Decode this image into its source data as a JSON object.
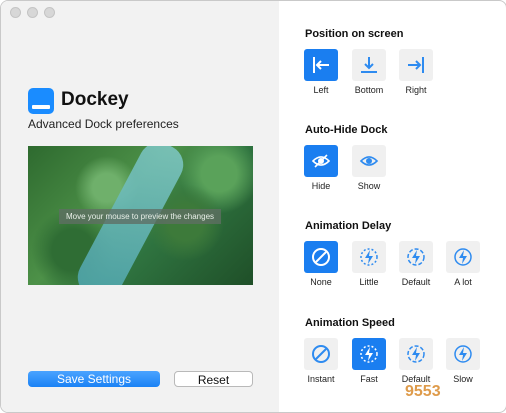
{
  "window": {
    "traffic_lights": [
      "close",
      "minimize",
      "zoom"
    ]
  },
  "app": {
    "title": "Dockey",
    "subtitle": "Advanced Dock preferences",
    "icon": "dock-icon"
  },
  "preview": {
    "hint": "Move your mouse to preview the changes"
  },
  "buttons": {
    "save": "Save Settings",
    "reset": "Reset"
  },
  "sections": {
    "position": {
      "title": "Position on screen",
      "options": [
        {
          "label": "Left",
          "icon": "arrow-left-icon",
          "selected": true
        },
        {
          "label": "Bottom",
          "icon": "arrow-down-icon",
          "selected": false
        },
        {
          "label": "Right",
          "icon": "arrow-right-icon",
          "selected": false
        }
      ]
    },
    "autohide": {
      "title": "Auto-Hide Dock",
      "options": [
        {
          "label": "Hide",
          "icon": "eye-slash-icon",
          "selected": true
        },
        {
          "label": "Show",
          "icon": "eye-icon",
          "selected": false
        }
      ]
    },
    "delay": {
      "title": "Animation Delay",
      "options": [
        {
          "label": "None",
          "icon": "no-icon",
          "selected": true
        },
        {
          "label": "Little",
          "icon": "bolt-dotted-icon",
          "selected": false
        },
        {
          "label": "Default",
          "icon": "bolt-dotted-icon",
          "selected": false
        },
        {
          "label": "A lot",
          "icon": "bolt-circle-icon",
          "selected": false
        }
      ]
    },
    "speed": {
      "title": "Animation Speed",
      "options": [
        {
          "label": "Instant",
          "icon": "no-icon",
          "selected": false
        },
        {
          "label": "Fast",
          "icon": "bolt-dotted-icon",
          "selected": true
        },
        {
          "label": "Default",
          "icon": "bolt-dotted-icon",
          "selected": false
        },
        {
          "label": "Slow",
          "icon": "bolt-circle-icon",
          "selected": false
        }
      ]
    }
  },
  "watermark": "9553",
  "colors": {
    "accent": "#1a7ef0",
    "icon_blue": "#2e8bf0"
  }
}
